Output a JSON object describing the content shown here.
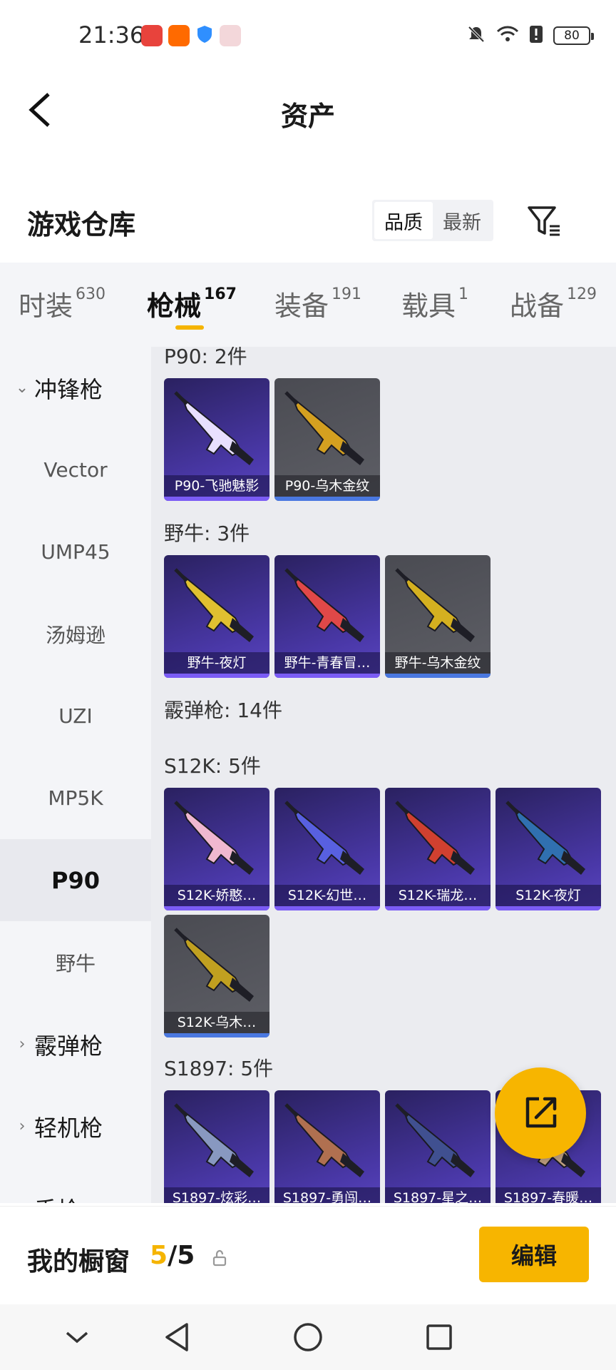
{
  "status_bar": {
    "time": "21:36",
    "battery": "80",
    "icons": [
      "app-icon-huawei",
      "app-icon-taobao",
      "shield-icon",
      "app-icon-box",
      "mute-icon",
      "wifi-icon",
      "alert-icon",
      "battery-icon"
    ]
  },
  "header": {
    "title": "资产",
    "back_icon": "back-arrow-icon"
  },
  "warehouse": {
    "title": "游戏仓库",
    "sort_options": [
      "品质",
      "最新"
    ],
    "sort_active": "品质",
    "filter_icon": "filter-icon"
  },
  "tabs": [
    {
      "label": "时装",
      "count": "630"
    },
    {
      "label": "枪械",
      "count": "167"
    },
    {
      "label": "装备",
      "count": "191"
    },
    {
      "label": "载具",
      "count": "1"
    },
    {
      "label": "战备",
      "count": "129"
    }
  ],
  "active_tab": "枪械",
  "sidebar": {
    "group_expanded": "冲锋枪",
    "items": [
      "Vector",
      "UMP45",
      "汤姆逊",
      "UZI",
      "MP5K",
      "P90",
      "野牛"
    ],
    "selected": "P90",
    "groups_collapsed": [
      "霰弹枪",
      "轻机枪",
      "手枪"
    ]
  },
  "content": {
    "groups": [
      {
        "label": "P90: 2件",
        "items": [
          {
            "name": "P90-飞驰魅影",
            "rarity": "purple",
            "color": "#e8e0ff"
          },
          {
            "name": "P90-乌木金纹",
            "rarity": "gray",
            "color": "#d4a020"
          }
        ]
      },
      {
        "label": "野牛: 3件",
        "items": [
          {
            "name": "野牛-夜灯",
            "rarity": "purple",
            "color": "#e0c030"
          },
          {
            "name": "野牛-青春冒…",
            "rarity": "purple",
            "color": "#e04848"
          },
          {
            "name": "野牛-乌木金纹",
            "rarity": "gray",
            "color": "#d4b020"
          }
        ]
      },
      {
        "label": "霰弹枪: 14件",
        "items": []
      },
      {
        "label": "S12K: 5件",
        "items": [
          {
            "name": "S12K-娇憨…",
            "rarity": "purple",
            "color": "#f0b8d0"
          },
          {
            "name": "S12K-幻世…",
            "rarity": "purple",
            "color": "#5860e0"
          },
          {
            "name": "S12K-瑞龙…",
            "rarity": "purple",
            "color": "#d04030"
          },
          {
            "name": "S12K-夜灯",
            "rarity": "purple",
            "color": "#3070b0"
          },
          {
            "name": "S12K-乌木…",
            "rarity": "gray",
            "color": "#c0a020"
          }
        ]
      },
      {
        "label": "S1897: 5件",
        "items": [
          {
            "name": "S1897-炫彩…",
            "rarity": "purple",
            "color": "#8898c0"
          },
          {
            "name": "S1897-勇闯…",
            "rarity": "purple",
            "color": "#b07050"
          },
          {
            "name": "S1897-星之…",
            "rarity": "purple",
            "color": "#405090"
          },
          {
            "name": "S1897-春暖…",
            "rarity": "purple",
            "color": "#c0a080"
          }
        ]
      }
    ]
  },
  "fab_icon": "share-edit-icon",
  "bottom_bar": {
    "label": "我的橱窗",
    "count_current": "5",
    "count_sep": "/",
    "count_total": "5",
    "edit_label": "编辑"
  },
  "nav_bar": [
    "chevron-down-icon",
    "back-triangle-icon",
    "home-circle-icon",
    "recents-square-icon"
  ],
  "colors": {
    "accent": "#f7b500",
    "card_purple": "#4a38a8",
    "card_gray": "#5e5f66"
  }
}
